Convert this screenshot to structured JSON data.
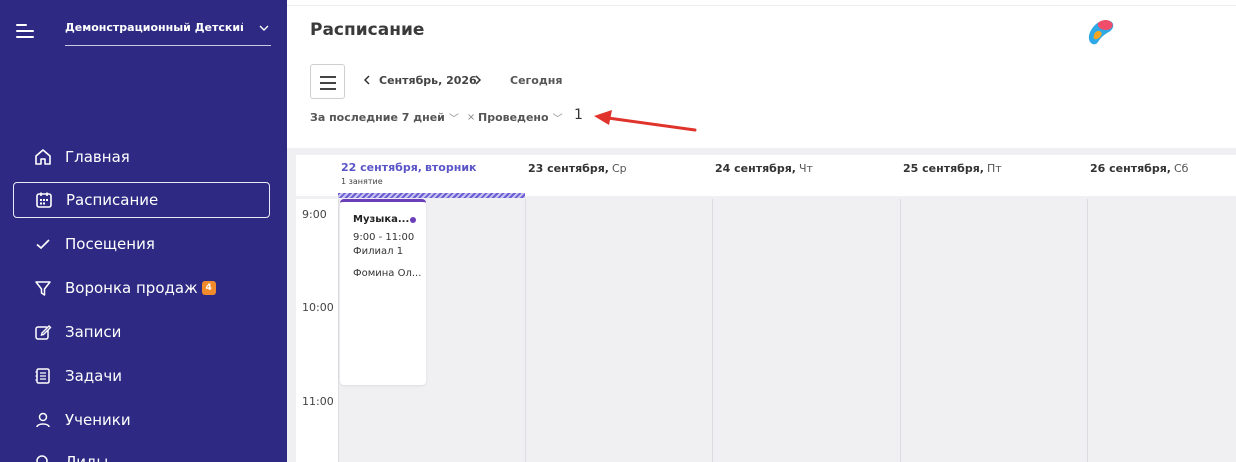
{
  "sidebar": {
    "org_name": "Демонстрационный Детский ц...",
    "items": [
      {
        "label": "Главная",
        "icon": "home-icon"
      },
      {
        "label": "Расписание",
        "icon": "calendar-icon",
        "active": true
      },
      {
        "label": "Посещения",
        "icon": "check-icon"
      },
      {
        "label": "Воронка продаж",
        "icon": "funnel-icon",
        "badge": "4"
      },
      {
        "label": "Записи",
        "icon": "edit-icon"
      },
      {
        "label": "Задачи",
        "icon": "tasks-icon"
      },
      {
        "label": "Ученики",
        "icon": "user-icon"
      },
      {
        "label": "Лиды",
        "icon": "search-icon"
      }
    ]
  },
  "header": {
    "title": "Расписание",
    "month": "Сентябрь, 2026",
    "today": "Сегодня"
  },
  "filters": {
    "period": "За последние 7 дней",
    "status": "Проведено",
    "annotation": "1"
  },
  "calendar": {
    "days": [
      {
        "date": "22 сентября,",
        "dow": "вторник",
        "count": "1 занятие",
        "today": true
      },
      {
        "date": "23 сентября,",
        "dow": "Ср"
      },
      {
        "date": "24 сентября,",
        "dow": "Чт"
      },
      {
        "date": "25 сентября,",
        "dow": "Пт"
      },
      {
        "date": "26 сентября,",
        "dow": "Сб"
      }
    ],
    "times": [
      "9:00",
      "10:00",
      "11:00"
    ],
    "event": {
      "title": "Музыка...",
      "time": "9:00 - 11:00",
      "branch": "Филиал 1",
      "teacher": "Фомина Ол..."
    }
  },
  "colors": {
    "sidebar_bg": "#2e2a83",
    "accent": "#5b56c8",
    "event_accent": "#6a3fb8",
    "badge": "#f28b2c",
    "annotation_arrow": "#e0332b"
  }
}
